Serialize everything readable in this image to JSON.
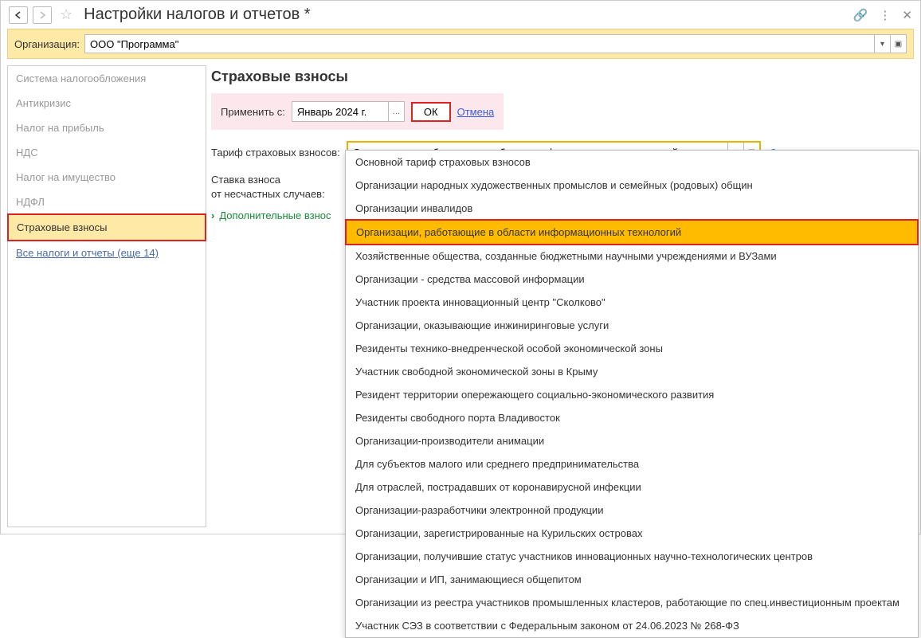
{
  "title": "Настройки налогов и отчетов *",
  "org": {
    "label": "Организация:",
    "value": "ООО \"Программа\""
  },
  "sidebar": {
    "items": [
      {
        "label": "Система налогообложения"
      },
      {
        "label": "Антикризис"
      },
      {
        "label": "Налог на прибыль"
      },
      {
        "label": "НДС"
      },
      {
        "label": "Налог на имущество"
      },
      {
        "label": "НДФЛ"
      },
      {
        "label": "Страховые взносы",
        "active": true
      },
      {
        "label": "Все налоги и отчеты (еще 14)",
        "link": true
      }
    ]
  },
  "section_title": "Страховые взносы",
  "apply": {
    "label": "Применить с:",
    "value": "Январь 2024 г.",
    "ok": "ОК",
    "cancel": "Отмена"
  },
  "tariff": {
    "label": "Тариф страховых взносов:",
    "value": "Организации, работающие в области информационных технологий"
  },
  "rate_label_line1": "Ставка взноса",
  "rate_label_line2": "от несчастных случаев:",
  "extra_link": "Дополнительные взнос",
  "dropdown": {
    "items": [
      "Основной тариф страховых взносов",
      "Организации народных художественных промыслов и семейных (родовых) общин",
      "Организации инвалидов",
      "Организации, работающие в области информационных технологий",
      "Хозяйственные общества, созданные бюджетными научными учреждениями и ВУЗами",
      "Организации - средства массовой информации",
      "Участник проекта инновационный центр \"Сколково\"",
      "Организации, оказывающие инжиниринговые услуги",
      "Резиденты технико-внедренческой особой экономической зоны",
      "Участник свободной экономической зоны в Крыму",
      "Резидент территории опережающего социально-экономического развития",
      "Резиденты свободного порта Владивосток",
      "Организации-производители анимации",
      "Для субъектов малого или среднего предпринимательства",
      "Для отраслей, пострадавших от коронавирусной инфекции",
      "Организации-разработчики электронной продукции",
      "Организации, зарегистрированные на Курильских островах",
      "Организации, получившие статус участников инновационных научно-технологических центров",
      "Организации и ИП, занимающиеся общепитом",
      "Организации из реестра участников промышленных кластеров, работающие по спец.инвестиционным проектам",
      "Участник СЭЗ в соответствии с Федеральным законом от 24.06.2023 № 268-ФЗ"
    ],
    "selected_index": 3
  }
}
